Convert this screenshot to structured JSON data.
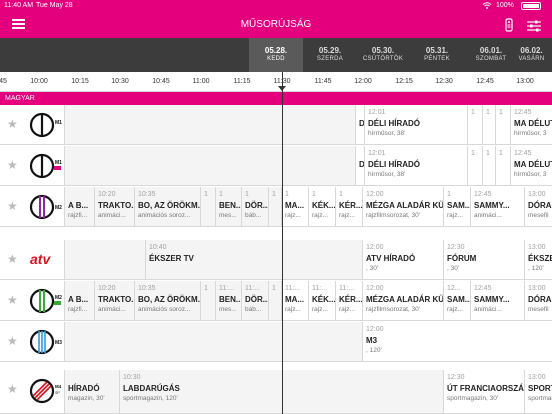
{
  "status": {
    "time": "11:40 AM",
    "date": "Tue May 28",
    "battery": "100%"
  },
  "nav": {
    "title": "MŰSORÚJSÁG",
    "menu_icon": "hamburger-icon",
    "remote_icon": "remote-icon",
    "filter_icon": "sliders-icon"
  },
  "dates": [
    {
      "day": "05.28.",
      "weekday": "KEDD",
      "active": true
    },
    {
      "day": "05.29.",
      "weekday": "SZERDA"
    },
    {
      "day": "05.30.",
      "weekday": "CSÜTÖRTÖK"
    },
    {
      "day": "05.31.",
      "weekday": "PÉNTEK"
    },
    {
      "day": "06.01.",
      "weekday": "SZOMBAT"
    },
    {
      "day": "06.02.",
      "weekday": "VASÁRN"
    }
  ],
  "timeline": [
    "45",
    "10:00",
    "10:15",
    "10:30",
    "10:45",
    "11:00",
    "11:15",
    "11:30",
    "11:45",
    "12:00",
    "12:15",
    "12:30",
    "12:45",
    "13:00"
  ],
  "section_label": "MAGYAR",
  "channels": [
    {
      "logo": "M1",
      "programs": [
        {
          "time": "",
          "name": "",
          "sub": ""
        },
        {
          "time": "",
          "name": "D",
          "sub": ""
        },
        {
          "time": "12:01",
          "name": "DÉLI HÍRADÓ",
          "sub": "hírműsor, 38'"
        },
        {
          "time": "1",
          "name": "",
          "sub": ""
        },
        {
          "time": "1",
          "name": "",
          "sub": ""
        },
        {
          "time": "1",
          "name": "",
          "sub": ""
        },
        {
          "time": "12:45",
          "name": "MA DÉLUTÁ",
          "sub": "hírműsor, 3"
        }
      ]
    },
    {
      "logo": "M1 HD",
      "programs": [
        {
          "time": "",
          "name": "",
          "sub": ""
        },
        {
          "time": "",
          "name": "D",
          "sub": ""
        },
        {
          "time": "12:01",
          "name": "DÉLI HÍRADÓ",
          "sub": "hírműsor, 38'"
        },
        {
          "time": "1",
          "name": "",
          "sub": ""
        },
        {
          "time": "1",
          "name": "",
          "sub": ""
        },
        {
          "time": "1",
          "name": "",
          "sub": ""
        },
        {
          "time": "12:45",
          "name": "MA DÉLUTÁ",
          "sub": "hírműsor, 3"
        }
      ]
    },
    {
      "logo": "M2",
      "programs": [
        {
          "time": "",
          "name": "A B...",
          "sub": "rajzfi..."
        },
        {
          "time": "10:20",
          "name": "TRAKTO...",
          "sub": "animáci..."
        },
        {
          "time": "10:35",
          "name": "BO, AZ ÖRÖKM...",
          "sub": "animációs soroz..."
        },
        {
          "time": "1",
          "name": "",
          "sub": ""
        },
        {
          "time": "1",
          "name": "BEN...",
          "sub": "mes..."
        },
        {
          "time": "1",
          "name": "DÖR...",
          "sub": "báb..."
        },
        {
          "time": "1",
          "name": "",
          "sub": ""
        },
        {
          "time": "1",
          "name": "MA...",
          "sub": "rajz..."
        },
        {
          "time": "1",
          "name": "KÉK...",
          "sub": "rajz..."
        },
        {
          "time": "1",
          "name": "KÉR...",
          "sub": "rajz..."
        },
        {
          "time": "12:00",
          "name": "MÉZGA ALADÁR KÜ...",
          "sub": "rajzfilmsorozat, 30'"
        },
        {
          "time": "1",
          "name": "SAM...",
          "sub": "rajz..."
        },
        {
          "time": "12:45",
          "name": "SAMMY...",
          "sub": "animáci..."
        },
        {
          "time": "13:00",
          "name": "DÓRA,",
          "sub": "mesefil"
        }
      ]
    },
    {
      "logo": "ATV",
      "programs": [
        {
          "time": "",
          "name": "",
          "sub": ""
        },
        {
          "time": "10:40",
          "name": "ÉKSZER TV",
          "sub": ""
        },
        {
          "time": "12:00",
          "name": "ATV HÍRADÓ",
          "sub": ", 30'"
        },
        {
          "time": "12:30",
          "name": "FÓRUM",
          "sub": ", 30'"
        },
        {
          "time": "13:00",
          "name": "ÉKSZER",
          "sub": ", 120'"
        }
      ]
    },
    {
      "logo": "M2 HD",
      "programs": [
        {
          "time": "",
          "name": "A B...",
          "sub": "rajzfi..."
        },
        {
          "time": "10:20",
          "name": "TRAKTO...",
          "sub": "animáci..."
        },
        {
          "time": "10:35",
          "name": "BO, AZ ÖRÖKM...",
          "sub": "animációs soroz..."
        },
        {
          "time": "1",
          "name": "",
          "sub": ""
        },
        {
          "time": "11:...",
          "name": "BEN...",
          "sub": "mes..."
        },
        {
          "time": "11:...",
          "name": "DÖR...",
          "sub": "báb..."
        },
        {
          "time": "1",
          "name": "",
          "sub": ""
        },
        {
          "time": "11:...",
          "name": "MA...",
          "sub": "rajz..."
        },
        {
          "time": "11:...",
          "name": "KÉK...",
          "sub": "rajz..."
        },
        {
          "time": "11:...",
          "name": "KÉR...",
          "sub": "rajz..."
        },
        {
          "time": "12:00",
          "name": "MÉZGA ALADÁR KÜ...",
          "sub": "rajzfilmsorozat, 30'"
        },
        {
          "time": "12...",
          "name": "SAM...",
          "sub": "rajz..."
        },
        {
          "time": "12:45",
          "name": "SAMMY...",
          "sub": "animáci..."
        },
        {
          "time": "13:00",
          "name": "DÓRA,",
          "sub": "mesefil"
        }
      ]
    },
    {
      "logo": "M3",
      "programs": [
        {
          "time": "",
          "name": "",
          "sub": ""
        },
        {
          "time": "12:00",
          "name": "M3",
          "sub": ", 120'"
        }
      ]
    },
    {
      "logo": "M4 SPORT",
      "programs": [
        {
          "time": "",
          "name": "HÍRADÓ",
          "sub": "magazin, 30'"
        },
        {
          "time": "10:30",
          "name": "LABDARÚGÁS",
          "sub": "sportmagazin, 120'"
        },
        {
          "time": "12:30",
          "name": "ÚT FRANCIAORSZÁ...",
          "sub": "sportmagazin, 30'"
        },
        {
          "time": "13:00",
          "name": "SPORT",
          "sub": "sportmag"
        }
      ]
    }
  ],
  "colors": {
    "brand": "#e4007d",
    "datebar": "#3c3c3c"
  }
}
